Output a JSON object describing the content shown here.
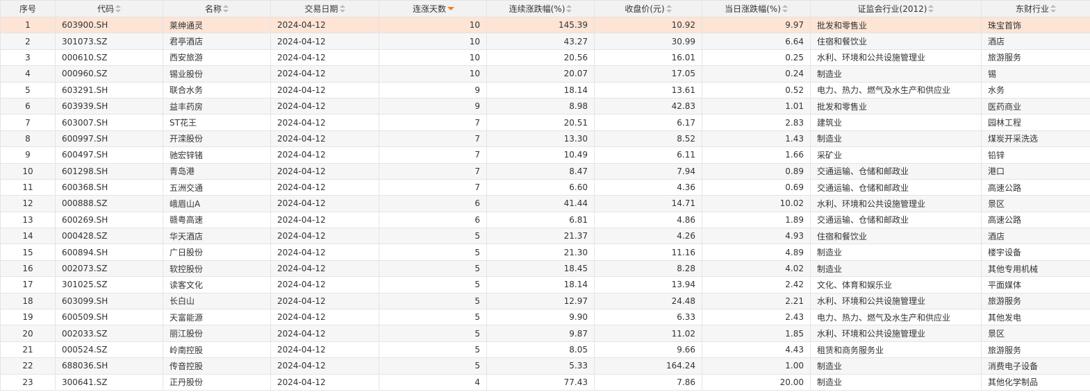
{
  "colors": {
    "header_bg": "#f2f2f2",
    "highlight_row": "#fde4d5",
    "sort_active": "#ff7a1a",
    "grid": "#e4e4e4"
  },
  "table": {
    "headers": [
      "序号",
      "代码",
      "名称",
      "交易日期",
      "连涨天数",
      "连续涨跌幅(%)",
      "收盘价(元)",
      "当日涨跌幅(%)",
      "证监会行业(2012)",
      "东财行业"
    ],
    "sorted_column": "连涨天数",
    "sort_direction": "desc",
    "rows": [
      [
        "1",
        "603900.SH",
        "莱绅通灵",
        "2024-04-12",
        "10",
        "145.39",
        "10.92",
        "9.97",
        "批发和零售业",
        "珠宝首饰"
      ],
      [
        "2",
        "301073.SZ",
        "君亭酒店",
        "2024-04-12",
        "10",
        "43.27",
        "30.99",
        "6.64",
        "住宿和餐饮业",
        "酒店"
      ],
      [
        "3",
        "000610.SZ",
        "西安旅游",
        "2024-04-12",
        "10",
        "20.56",
        "16.01",
        "0.25",
        "水利、环境和公共设施管理业",
        "旅游服务"
      ],
      [
        "4",
        "000960.SZ",
        "锡业股份",
        "2024-04-12",
        "10",
        "20.07",
        "17.05",
        "0.24",
        "制造业",
        "锡"
      ],
      [
        "5",
        "603291.SH",
        "联合水务",
        "2024-04-12",
        "9",
        "18.14",
        "13.61",
        "0.52",
        "电力、热力、燃气及水生产和供应业",
        "水务"
      ],
      [
        "6",
        "603939.SH",
        "益丰药房",
        "2024-04-12",
        "9",
        "8.98",
        "42.83",
        "1.01",
        "批发和零售业",
        "医药商业"
      ],
      [
        "7",
        "603007.SH",
        "ST花王",
        "2024-04-12",
        "7",
        "20.51",
        "6.17",
        "2.83",
        "建筑业",
        "园林工程"
      ],
      [
        "8",
        "600997.SH",
        "开滦股份",
        "2024-04-12",
        "7",
        "13.30",
        "8.52",
        "1.43",
        "制造业",
        "煤炭开采洗选"
      ],
      [
        "9",
        "600497.SH",
        "驰宏锌锗",
        "2024-04-12",
        "7",
        "10.49",
        "6.11",
        "1.66",
        "采矿业",
        "铅锌"
      ],
      [
        "10",
        "601298.SH",
        "青岛港",
        "2024-04-12",
        "7",
        "8.47",
        "7.94",
        "0.89",
        "交通运输、仓储和邮政业",
        "港口"
      ],
      [
        "11",
        "600368.SH",
        "五洲交通",
        "2024-04-12",
        "7",
        "6.60",
        "4.36",
        "0.69",
        "交通运输、仓储和邮政业",
        "高速公路"
      ],
      [
        "12",
        "000888.SZ",
        "峨眉山A",
        "2024-04-12",
        "6",
        "41.44",
        "14.71",
        "10.02",
        "水利、环境和公共设施管理业",
        "景区"
      ],
      [
        "13",
        "600269.SH",
        "赣粤高速",
        "2024-04-12",
        "6",
        "6.81",
        "4.86",
        "1.89",
        "交通运输、仓储和邮政业",
        "高速公路"
      ],
      [
        "14",
        "000428.SZ",
        "华天酒店",
        "2024-04-12",
        "5",
        "21.37",
        "4.26",
        "4.93",
        "住宿和餐饮业",
        "酒店"
      ],
      [
        "15",
        "600894.SH",
        "广日股份",
        "2024-04-12",
        "5",
        "21.30",
        "11.16",
        "4.89",
        "制造业",
        "楼宇设备"
      ],
      [
        "16",
        "002073.SZ",
        "软控股份",
        "2024-04-12",
        "5",
        "18.45",
        "8.28",
        "4.02",
        "制造业",
        "其他专用机械"
      ],
      [
        "17",
        "301025.SZ",
        "读客文化",
        "2024-04-12",
        "5",
        "18.14",
        "13.94",
        "2.42",
        "文化、体育和娱乐业",
        "平面媒体"
      ],
      [
        "18",
        "603099.SH",
        "长白山",
        "2024-04-12",
        "5",
        "12.97",
        "24.48",
        "2.21",
        "水利、环境和公共设施管理业",
        "旅游服务"
      ],
      [
        "19",
        "600509.SH",
        "天富能源",
        "2024-04-12",
        "5",
        "9.90",
        "6.33",
        "2.43",
        "电力、热力、燃气及水生产和供应业",
        "其他发电"
      ],
      [
        "20",
        "002033.SZ",
        "丽江股份",
        "2024-04-12",
        "5",
        "9.87",
        "11.02",
        "1.85",
        "水利、环境和公共设施管理业",
        "景区"
      ],
      [
        "21",
        "000524.SZ",
        "岭南控股",
        "2024-04-12",
        "5",
        "8.05",
        "9.66",
        "4.43",
        "租赁和商务服务业",
        "旅游服务"
      ],
      [
        "22",
        "688036.SH",
        "传音控股",
        "2024-04-12",
        "5",
        "5.33",
        "164.24",
        "1.00",
        "制造业",
        "消费电子设备"
      ],
      [
        "23",
        "300641.SZ",
        "正丹股份",
        "2024-04-12",
        "4",
        "77.43",
        "7.86",
        "20.00",
        "制造业",
        "其他化学制品"
      ]
    ]
  }
}
